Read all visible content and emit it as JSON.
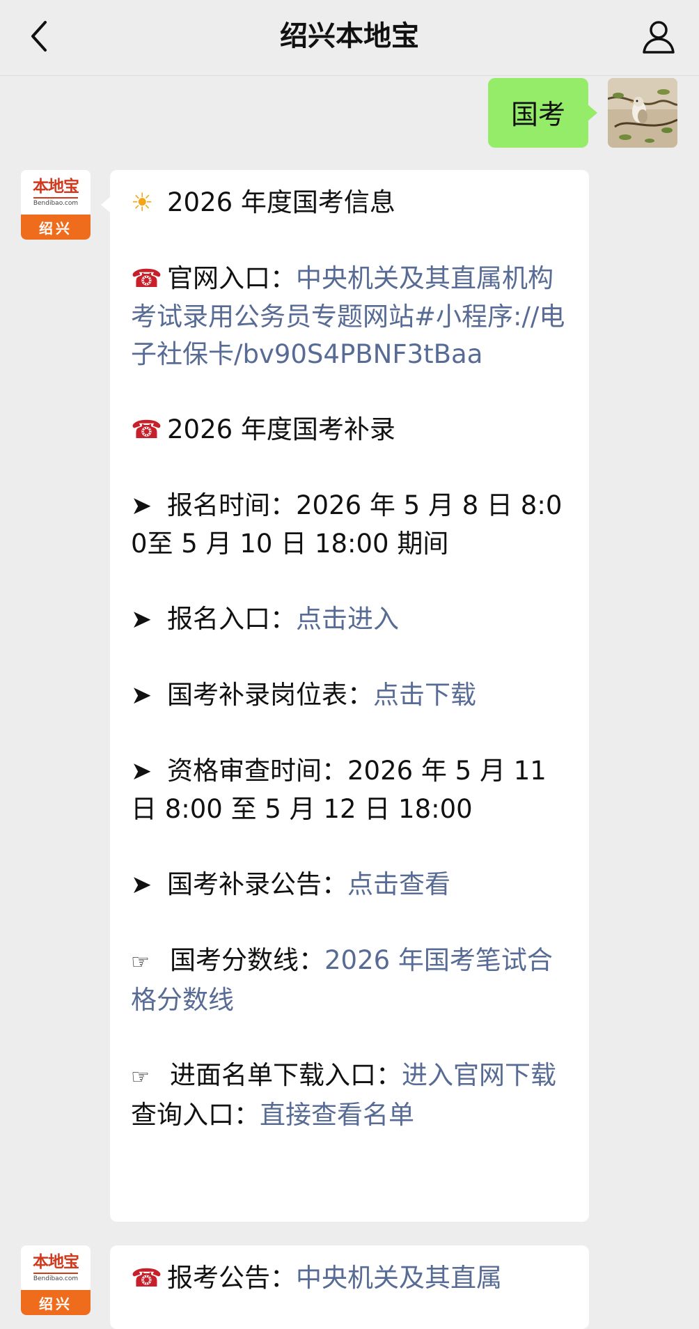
{
  "header": {
    "title": "绍兴本地宝"
  },
  "user_message": {
    "text": "国考"
  },
  "bot_avatar": {
    "brand": "本地宝",
    "url": "Bendibao.com",
    "city": "绍兴"
  },
  "message1": {
    "heading_icon": "☀️",
    "heading": "2026 年度国考信息",
    "official": {
      "icon": "☎️",
      "label": "官网入口：",
      "link": "中央机关及其直属机构考试录用公务员专题网站#小程序://电子社保卡/bv90S4PBNF3tBaa"
    },
    "supplement": {
      "icon": "☎️",
      "text": "2026 年度国考补录"
    },
    "signup_time": {
      "icon": "➤",
      "label": "报名时间：",
      "value": "2026 年 5 月 8 日 8:00至 5 月 10 日 18:00 期间"
    },
    "signup_entry": {
      "icon": "➤",
      "label": "报名入口：",
      "link": "点击进入"
    },
    "positions": {
      "icon": "➤",
      "label": "国考补录岗位表：",
      "link": "点击下载"
    },
    "review_time": {
      "icon": "➤",
      "label": "资格审查时间：",
      "value": "2026 年 5 月 11 日 8:00 至 5 月 12 日 18:00"
    },
    "notice": {
      "icon": "➤",
      "label": "国考补录公告：",
      "link": "点击查看"
    },
    "score_line": {
      "icon": "☞",
      "label": "国考分数线：",
      "link": "2026 年国考笔试合格分数线"
    },
    "interview_list": {
      "icon": "☞",
      "label": "进面名单下载入口：",
      "link": "进入官网下载"
    },
    "query": {
      "label": "查询入口：",
      "link": "直接查看名单"
    }
  },
  "message2": {
    "icon": "☎️",
    "label": "报考公告：",
    "link": "中央机关及其直属"
  },
  "colors": {
    "bubble_green": "#95ec69",
    "link": "#576b95",
    "background": "#ededed"
  },
  "icons": {
    "back": "chevron-left-icon",
    "profile": "person-icon",
    "heading": "sun-icon",
    "phone": "telephone-icon",
    "arrow": "arrow-right-icon",
    "point": "pointing-hand-icon"
  }
}
